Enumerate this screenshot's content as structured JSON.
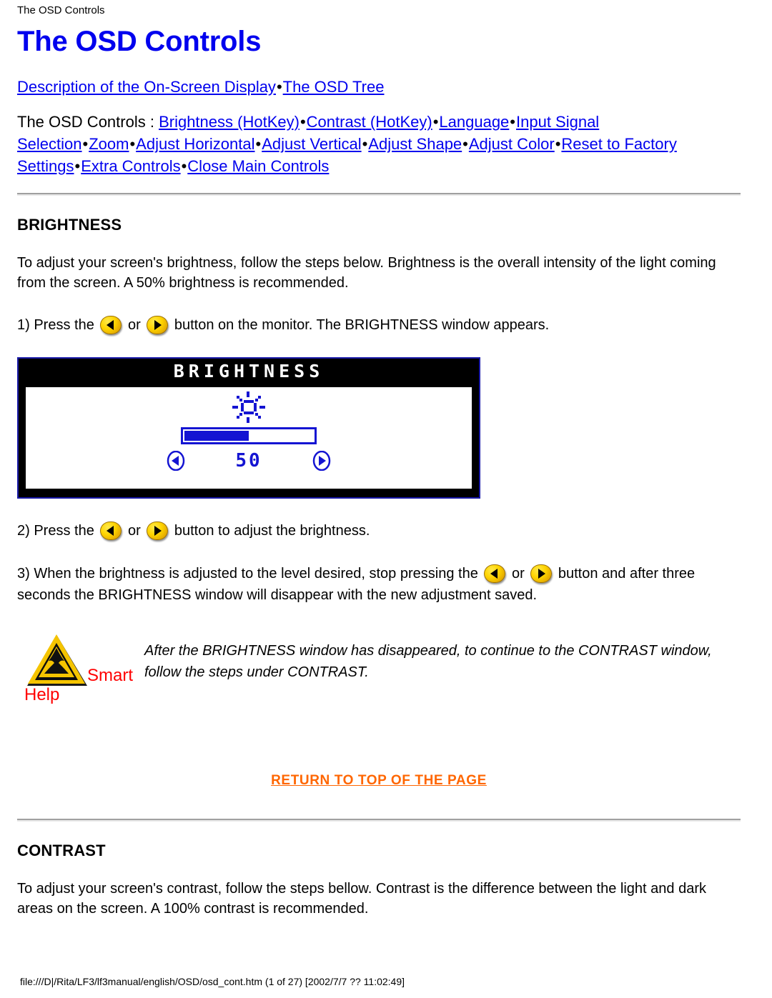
{
  "running_header": "The OSD Controls",
  "title": "The OSD Controls",
  "nav_primary": {
    "links": [
      {
        "label": "Description of the On-Screen Display"
      },
      {
        "label": "The OSD Tree"
      }
    ],
    "separator": "•"
  },
  "nav_secondary": {
    "prefix": "The OSD Controls :",
    "separator": "•",
    "links": [
      {
        "label": "Brightness (HotKey)"
      },
      {
        "label": "Contrast (HotKey)"
      },
      {
        "label": "Language"
      },
      {
        "label": "Input Signal Selection"
      },
      {
        "label": "Zoom"
      },
      {
        "label": "Adjust Horizontal"
      },
      {
        "label": "Adjust Vertical"
      },
      {
        "label": "Adjust Shape"
      },
      {
        "label": "Adjust Color"
      },
      {
        "label": "Reset to Factory Settings"
      },
      {
        "label": "Extra Controls"
      },
      {
        "label": "Close Main Controls"
      }
    ]
  },
  "brightness": {
    "heading": "BRIGHTNESS",
    "intro": "To adjust your screen's brightness, follow the steps below. Brightness is the overall intensity of the light coming from the screen. A 50% brightness is recommended.",
    "step1_a": "1) Press the",
    "step1_or": "or",
    "step1_b": "button on the monitor. The BRIGHTNESS window appears.",
    "step2_a": "2) Press the",
    "step2_or": "or",
    "step2_b": "button to adjust the brightness.",
    "step3_a": "3) When the brightness is adjusted to the level desired, stop pressing the",
    "step3_or": "or",
    "step3_b": "button and after three seconds the BRIGHTNESS window will disappear with the new adjustment saved."
  },
  "osd_window": {
    "title": "BRIGHTNESS",
    "value": "50",
    "fill_percent": 50,
    "title_bar_color": "#000000",
    "accent_color": "#1414d2",
    "border_color": "#1a1aa8"
  },
  "smart_help": {
    "word_smart": "Smart",
    "word_help": "Help",
    "text": "After the BRIGHTNESS window has disappeared, to continue to the CONTRAST window, follow the steps under CONTRAST.",
    "label_color": "#ff0000"
  },
  "return_top": {
    "label": "RETURN TO TOP OF THE PAGE",
    "color": "#ff6600"
  },
  "contrast": {
    "heading": "CONTRAST",
    "intro": "To adjust your screen's contrast, follow the steps bellow. Contrast is the difference between the light and dark areas on the screen. A 100% contrast is recommended."
  },
  "footer": "file:///D|/Rita/LF3/lf3manual/english/OSD/osd_cont.htm (1 of 27) [2002/7/7 ?? 11:02:49]"
}
